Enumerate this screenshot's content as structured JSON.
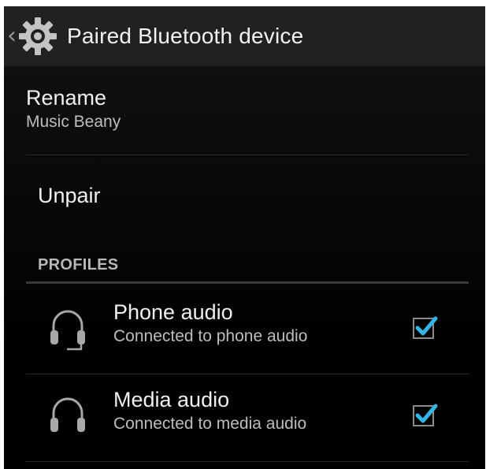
{
  "action_bar": {
    "title": "Paired Bluetooth device",
    "up_icon": "chevron-left-icon",
    "app_icon": "settings-gear-icon"
  },
  "preferences": {
    "rename": {
      "title": "Rename",
      "summary": "Music Beany"
    },
    "unpair": {
      "title": "Unpair"
    }
  },
  "profiles": {
    "header": "PROFILES",
    "items": [
      {
        "title": "Phone audio",
        "summary": "Connected to phone audio",
        "icon": "headset-mic-icon",
        "checked": true
      },
      {
        "title": "Media audio",
        "summary": "Connected to media audio",
        "icon": "headphones-icon",
        "checked": true
      }
    ]
  },
  "colors": {
    "accent": "#33b5e5",
    "background": "#000000",
    "action_bar": "#212121",
    "primary_text": "#f0f0f0",
    "secondary_text": "#bdbdbd"
  }
}
